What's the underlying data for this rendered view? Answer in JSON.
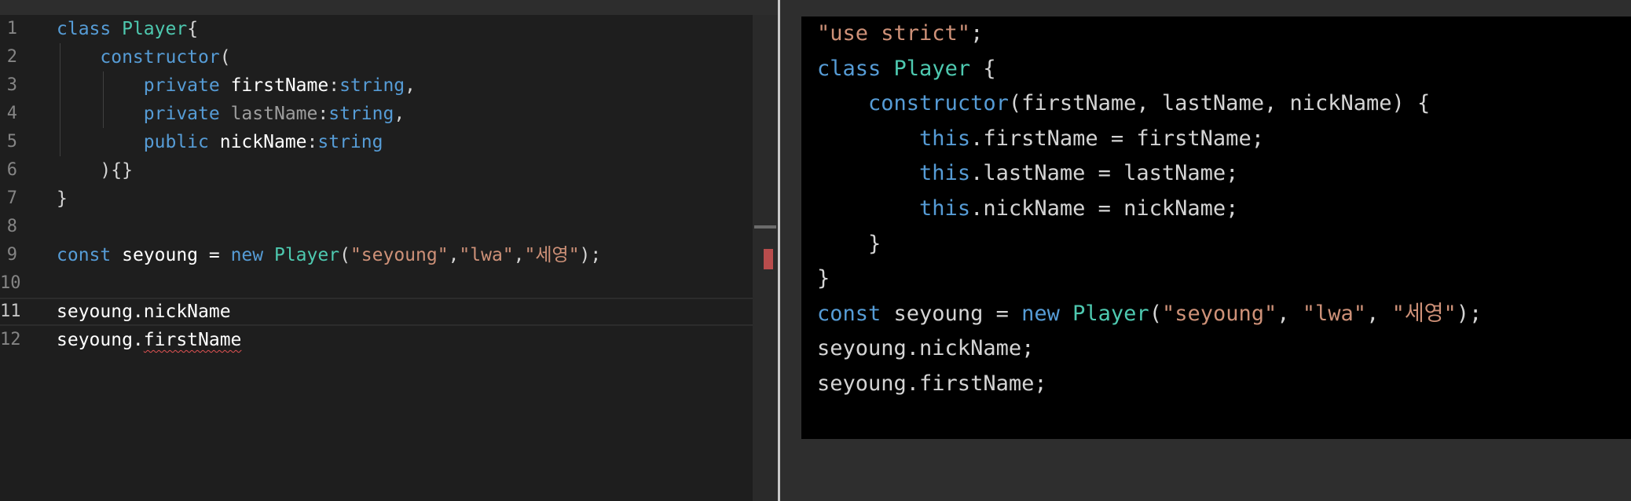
{
  "editor": {
    "lines": [
      {
        "n": "1",
        "code": [
          {
            "t": "class",
            "c": "kw"
          },
          {
            "t": " ",
            "c": "plain"
          },
          {
            "t": "Player",
            "c": "cls"
          },
          {
            "t": "{",
            "c": "plain"
          }
        ]
      },
      {
        "n": "2",
        "code": [
          {
            "t": "    ",
            "c": "plain"
          },
          {
            "t": "constructor",
            "c": "fn"
          },
          {
            "t": "(",
            "c": "plain"
          }
        ]
      },
      {
        "n": "3",
        "code": [
          {
            "t": "        ",
            "c": "plain"
          },
          {
            "t": "private",
            "c": "kw"
          },
          {
            "t": " ",
            "c": "plain"
          },
          {
            "t": "firstName",
            "c": "id"
          },
          {
            "t": ":",
            "c": "plain"
          },
          {
            "t": "string",
            "c": "kw"
          },
          {
            "t": ",",
            "c": "plain"
          }
        ]
      },
      {
        "n": "4",
        "code": [
          {
            "t": "        ",
            "c": "plain"
          },
          {
            "t": "private",
            "c": "kw"
          },
          {
            "t": " ",
            "c": "plain"
          },
          {
            "t": "lastName",
            "c": "id-dim"
          },
          {
            "t": ":",
            "c": "plain"
          },
          {
            "t": "string",
            "c": "kw"
          },
          {
            "t": ",",
            "c": "plain"
          }
        ]
      },
      {
        "n": "5",
        "code": [
          {
            "t": "        ",
            "c": "plain"
          },
          {
            "t": "public",
            "c": "kw"
          },
          {
            "t": " ",
            "c": "plain"
          },
          {
            "t": "nickName",
            "c": "id"
          },
          {
            "t": ":",
            "c": "plain"
          },
          {
            "t": "string",
            "c": "kw"
          }
        ]
      },
      {
        "n": "6",
        "code": [
          {
            "t": "    ",
            "c": "plain"
          },
          {
            "t": "){}",
            "c": "plain"
          }
        ]
      },
      {
        "n": "7",
        "code": [
          {
            "t": "}",
            "c": "plain"
          }
        ]
      },
      {
        "n": "8",
        "code": []
      },
      {
        "n": "9",
        "code": [
          {
            "t": "const",
            "c": "kw"
          },
          {
            "t": " seyoung = ",
            "c": "id"
          },
          {
            "t": "new",
            "c": "kw"
          },
          {
            "t": " ",
            "c": "plain"
          },
          {
            "t": "Player",
            "c": "cls"
          },
          {
            "t": "(",
            "c": "plain"
          },
          {
            "t": "\"seyoung\"",
            "c": "str"
          },
          {
            "t": ",",
            "c": "plain"
          },
          {
            "t": "\"lwa\"",
            "c": "str"
          },
          {
            "t": ",",
            "c": "plain"
          },
          {
            "t": "\"세영\"",
            "c": "str"
          },
          {
            "t": ");",
            "c": "plain"
          }
        ]
      },
      {
        "n": "10",
        "code": []
      },
      {
        "n": "11",
        "code": [
          {
            "t": "seyoung.nickName",
            "c": "id"
          }
        ],
        "current": true
      },
      {
        "n": "12",
        "code": [
          {
            "t": "seyoung.",
            "c": "id"
          },
          {
            "t": "firstName",
            "c": "id squiggle"
          }
        ]
      }
    ],
    "error_color": "#b84c4c"
  },
  "output": {
    "lines": [
      [
        {
          "t": "\"use strict\"",
          "c": "str"
        },
        {
          "t": ";",
          "c": "plain"
        }
      ],
      [
        {
          "t": "class",
          "c": "kw"
        },
        {
          "t": " ",
          "c": "plain"
        },
        {
          "t": "Player",
          "c": "cls"
        },
        {
          "t": " {",
          "c": "plain"
        }
      ],
      [
        {
          "t": "    ",
          "c": "plain"
        },
        {
          "t": "constructor",
          "c": "fn"
        },
        {
          "t": "(firstName, lastName, nickName) {",
          "c": "plain"
        }
      ],
      [
        {
          "t": "        ",
          "c": "plain"
        },
        {
          "t": "this",
          "c": "kw"
        },
        {
          "t": ".firstName = firstName;",
          "c": "plain"
        }
      ],
      [
        {
          "t": "        ",
          "c": "plain"
        },
        {
          "t": "this",
          "c": "kw"
        },
        {
          "t": ".lastName = lastName;",
          "c": "plain"
        }
      ],
      [
        {
          "t": "        ",
          "c": "plain"
        },
        {
          "t": "this",
          "c": "kw"
        },
        {
          "t": ".nickName = nickName;",
          "c": "plain"
        }
      ],
      [
        {
          "t": "    }",
          "c": "plain"
        }
      ],
      [
        {
          "t": "}",
          "c": "plain"
        }
      ],
      [
        {
          "t": "const",
          "c": "kw"
        },
        {
          "t": " seyoung = ",
          "c": "plain"
        },
        {
          "t": "new",
          "c": "kw"
        },
        {
          "t": " ",
          "c": "plain"
        },
        {
          "t": "Player",
          "c": "cls"
        },
        {
          "t": "(",
          "c": "plain"
        },
        {
          "t": "\"seyoung\"",
          "c": "str"
        },
        {
          "t": ", ",
          "c": "plain"
        },
        {
          "t": "\"lwa\"",
          "c": "str"
        },
        {
          "t": ", ",
          "c": "plain"
        },
        {
          "t": "\"세영\"",
          "c": "str"
        },
        {
          "t": ");",
          "c": "plain"
        }
      ],
      [
        {
          "t": "seyoung.nickName;",
          "c": "plain"
        }
      ],
      [
        {
          "t": "seyoung.firstName;",
          "c": "plain"
        }
      ]
    ]
  }
}
